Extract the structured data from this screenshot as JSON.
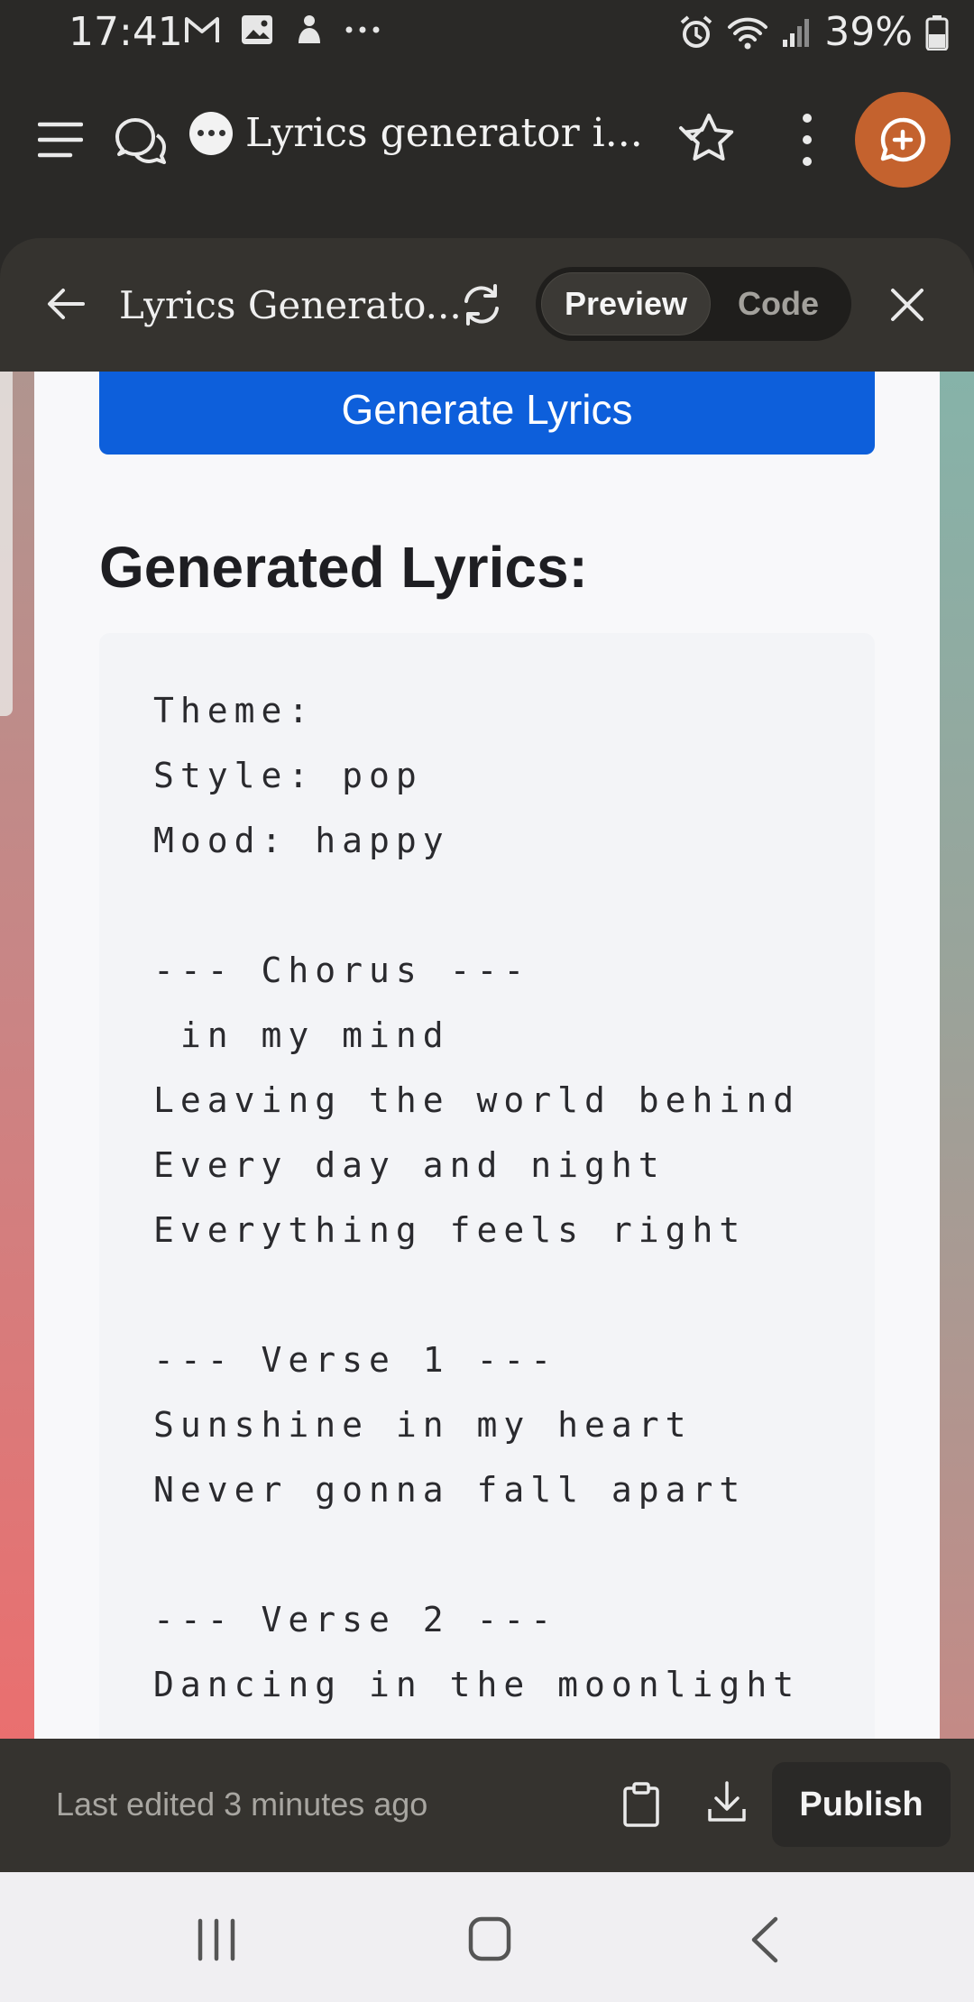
{
  "status_bar": {
    "time": "17:41",
    "battery": "39%",
    "left_icons": [
      "gmail-icon",
      "gallery-icon",
      "app-icon",
      "more-dots-icon"
    ],
    "right_icons": [
      "alarm-icon",
      "wifi-icon",
      "signal-icon",
      "battery-icon"
    ]
  },
  "app_bar": {
    "title": "Lyrics generator i...",
    "accent_color": "#c4622e"
  },
  "panel": {
    "title": "Lyrics Generato...",
    "tabs": [
      {
        "label": "Preview",
        "active": true
      },
      {
        "label": "Code",
        "active": false
      }
    ]
  },
  "preview": {
    "button_label": "Generate Lyrics",
    "button_color": "#0d5fdb",
    "heading": "Generated Lyrics:",
    "lyrics_text": "Theme:\nStyle: pop\nMood: happy\n\n--- Chorus ---\n in my mind\nLeaving the world behind\nEvery day and night\nEverything feels right\n\n--- Verse 1 ---\nSunshine in my heart\nNever gonna fall apart\n\n--- Verse 2 ---\nDancing in the moonlight"
  },
  "bottom_bar": {
    "status": "Last edited 3 minutes ago",
    "publish_label": "Publish"
  }
}
